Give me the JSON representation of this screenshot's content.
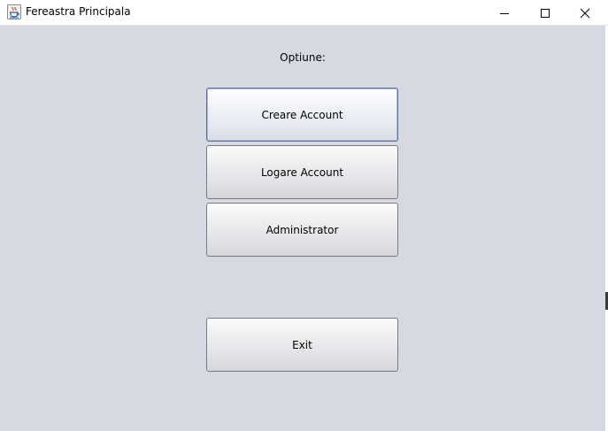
{
  "window": {
    "title": "Fereastra Principala",
    "icon": "java-cup-icon",
    "controls": [
      "minimize-icon",
      "maximize-icon",
      "close-icon"
    ]
  },
  "main": {
    "prompt_label": "Optiune:",
    "buttons": [
      {
        "label": "Creare Account",
        "focused": true
      },
      {
        "label": "Logare Account",
        "focused": false
      },
      {
        "label": "Administrator",
        "focused": false
      },
      {
        "label": "Exit",
        "focused": false
      }
    ]
  },
  "colors": {
    "background": "#d6d9e1",
    "titlebar": "#ffffff",
    "focus_border": "#5a6f93"
  }
}
